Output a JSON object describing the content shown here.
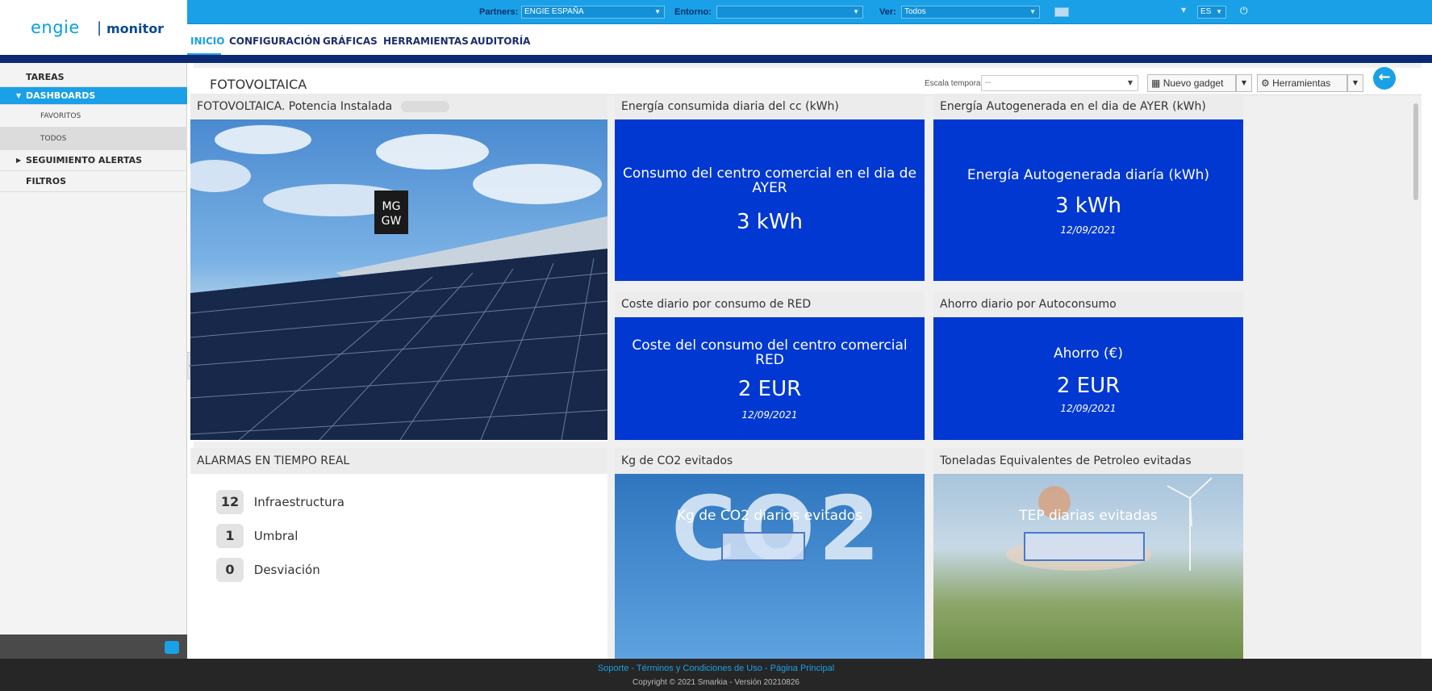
{
  "app": {
    "logo_brand": "engie",
    "logo_sep": "|",
    "logo_product": "monitor"
  },
  "filters": {
    "partners_label": "Partners:",
    "partners_value": "ENGIE ESPAÑA",
    "entorno_label": "Entorno:",
    "entorno_value": "",
    "ver_label": "Ver:",
    "ver_value": "Todos",
    "lang_value": "ES"
  },
  "nav": {
    "items": [
      "INICIO",
      "CONFIGURACIÓN",
      "GRÁFICAS",
      "HERRAMIENTAS",
      "AUDITORÍA"
    ],
    "active": "INICIO"
  },
  "sidebar": {
    "items": [
      {
        "label": "TAREAS"
      },
      {
        "label": "DASHBOARDS"
      },
      {
        "label": "FAVORITOS"
      },
      {
        "label": "TODOS"
      },
      {
        "label": "SEGUIMIENTO ALERTAS"
      },
      {
        "label": "FILTROS"
      }
    ]
  },
  "header": {
    "title": "FOTOVOLTAICA",
    "escala_label": "Escala temporal:",
    "escala_value": "--",
    "nuevo_gadget": "Nuevo gadget",
    "herramientas": "Herramientas"
  },
  "gadgets": {
    "potencia_title": "FOTOVOLTAICA. Potencia Instalada",
    "consumo": {
      "title": "Energía consumida diaria del cc (kWh)",
      "inner_title": "Consumo del centro comercial en el dia de AYER",
      "value": "3 kWh"
    },
    "autogenerada": {
      "title": "Energía Autogenerada en el dia de AYER (kWh)",
      "inner_title": "Energía Autogenerada diaría (kWh)",
      "value": "3 kWh",
      "date": "12/09/2021"
    },
    "coste": {
      "title": "Coste diario por consumo de RED",
      "inner_title": "Coste del consumo del centro comercial RED",
      "value": "2 EUR",
      "date": "12/09/2021"
    },
    "ahorro": {
      "title": "Ahorro diario por Autoconsumo",
      "inner_title": "Ahorro (€)",
      "value": "2 EUR",
      "date": "12/09/2021"
    },
    "alarmas": {
      "title": "ALARMAS EN TIEMPO REAL",
      "rows": [
        {
          "count": "12",
          "label": "Infraestructura"
        },
        {
          "count": "1",
          "label": "Umbral"
        },
        {
          "count": "0",
          "label": "Desviación"
        }
      ]
    },
    "co2": {
      "title": "Kg de CO2 evitados",
      "inner_title": "Kg de CO2 diarios evitados",
      "bg_text": "CO2"
    },
    "tep": {
      "title": "Toneladas Equivalentes de Petroleo evitadas",
      "inner_title": "TEP diarias evitadas"
    }
  },
  "footer": {
    "soporte": "Soporte",
    "terminos": "Términos y Condiciones de Uso",
    "principal": "Página Principal",
    "copyright": "Copyright © 2021 Smarkia - Versión 20210826"
  },
  "colors": {
    "accent": "#1aa0e6",
    "navy": "#0b2a73",
    "tile_blue": "#0038d1"
  }
}
